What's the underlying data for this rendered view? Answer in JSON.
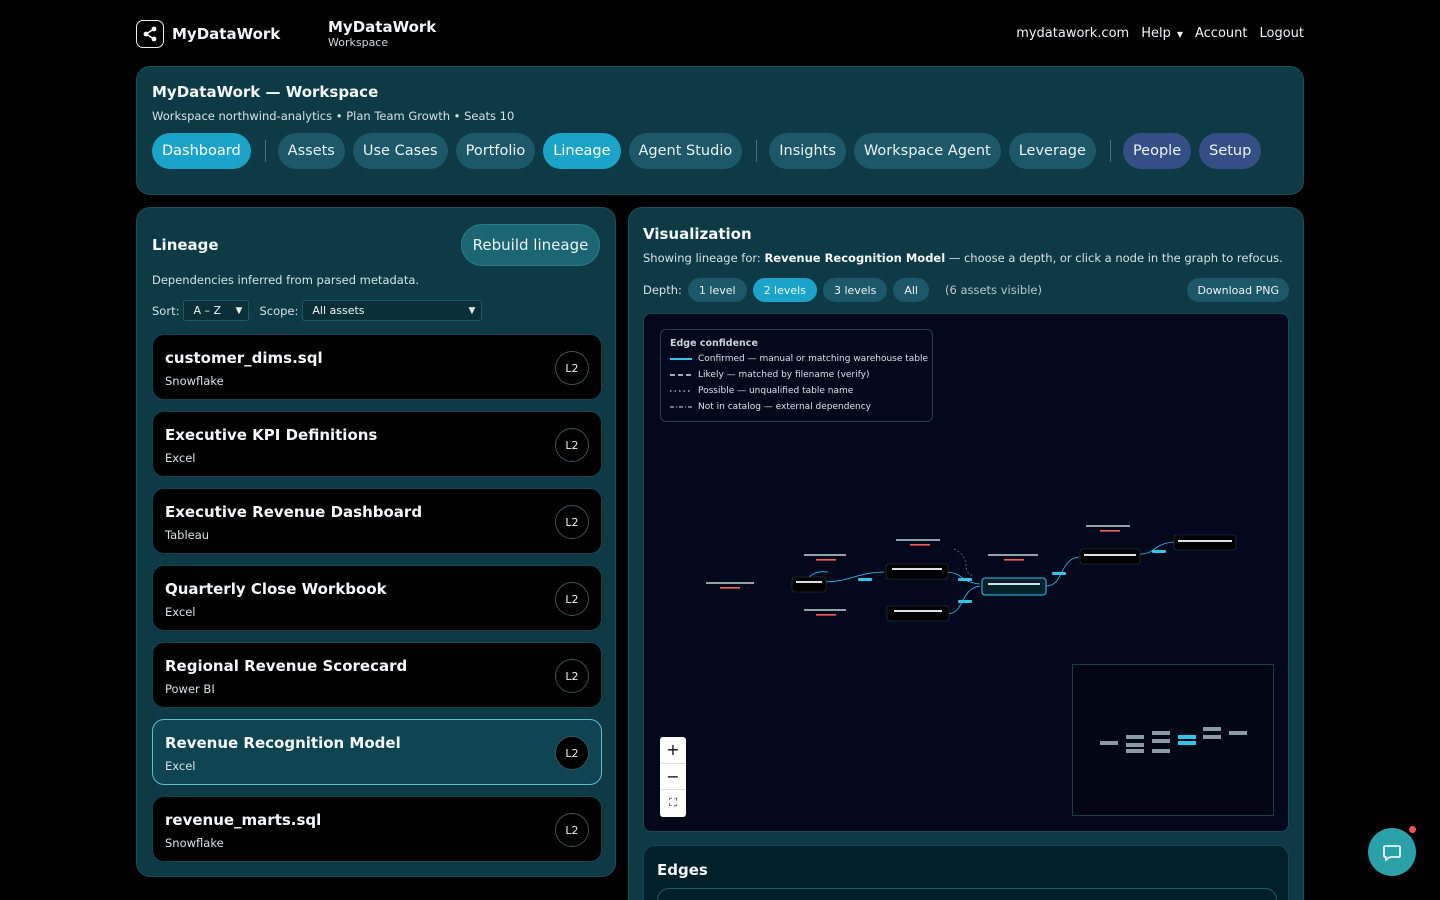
{
  "topbar": {
    "brand": "MyDataWork",
    "workspace_title": "MyDataWork",
    "workspace_sub": "Workspace",
    "links": {
      "site": "mydatawork.com",
      "help": "Help",
      "account": "Account",
      "logout": "Logout"
    }
  },
  "header": {
    "title": "MyDataWork — Workspace",
    "meta": "Workspace northwind-analytics • Plan Team Growth • Seats 10",
    "tabs": [
      "Dashboard",
      "Assets",
      "Use Cases",
      "Portfolio",
      "Lineage",
      "Agent Studio",
      "Insights",
      "Workspace Agent",
      "Leverage",
      "People",
      "Setup"
    ],
    "active_tab": "Lineage"
  },
  "lineage": {
    "title": "Lineage",
    "rebuild_label": "Rebuild lineage",
    "description": "Dependencies inferred from parsed metadata.",
    "sort_label": "Sort:",
    "sort_value": "A – Z",
    "scope_label": "Scope:",
    "scope_value": "All assets",
    "assets": [
      {
        "name": "customer_dims.sql",
        "type": "Snowflake",
        "level": "L2"
      },
      {
        "name": "Executive KPI Definitions",
        "type": "Excel",
        "level": "L2"
      },
      {
        "name": "Executive Revenue Dashboard",
        "type": "Tableau",
        "level": "L2"
      },
      {
        "name": "Quarterly Close Workbook",
        "type": "Excel",
        "level": "L2"
      },
      {
        "name": "Regional Revenue Scorecard",
        "type": "Power BI",
        "level": "L2"
      },
      {
        "name": "Revenue Recognition Model",
        "type": "Excel",
        "level": "L2"
      },
      {
        "name": "revenue_marts.sql",
        "type": "Snowflake",
        "level": "L2"
      }
    ],
    "selected_asset": "Revenue Recognition Model"
  },
  "viz": {
    "title": "Visualization",
    "desc_prefix": "Showing lineage for:",
    "desc_asset": "Revenue Recognition Model",
    "desc_suffix": "— choose a depth, or click a node in the graph to refocus.",
    "depth_label": "Depth:",
    "depth_options": [
      "1 level",
      "2 levels",
      "3 levels",
      "All"
    ],
    "active_depth": "2 levels",
    "visible_count": "(6 assets visible)",
    "download_label": "Download PNG",
    "legend": {
      "title": "Edge confidence",
      "items": [
        "Confirmed — manual or matching warehouse table",
        "Likely — matched by filename (verify)",
        "Possible — unqualified table name",
        "Not in catalog — external dependency"
      ]
    },
    "zoom": {
      "in": "+",
      "out": "−",
      "fit": "⛶"
    }
  },
  "edges": {
    "title": "Edges"
  },
  "colors": {
    "accent": "#1aa4c9",
    "panel": "#0d3a45",
    "edge_confirmed": "#2fc6e8"
  }
}
